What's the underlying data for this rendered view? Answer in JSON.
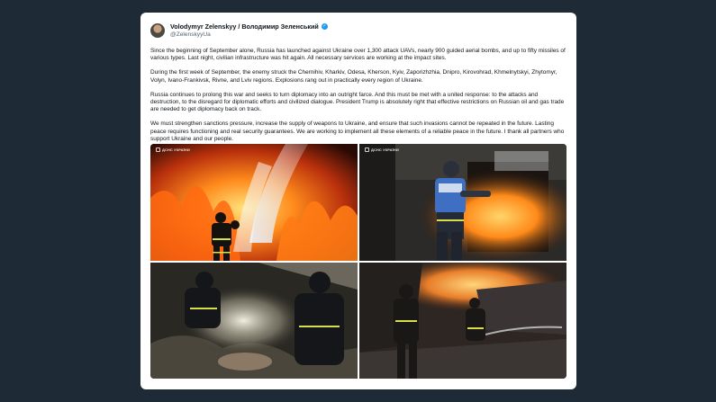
{
  "post": {
    "display_name": "Volodymyr Zelenskyy / Володимир Зеленський",
    "handle": "@ZelenskyyUa",
    "verified_icon": "verified-badge-icon",
    "paragraphs": [
      "Since the beginning of September alone, Russia has launched against Ukraine over 1,300 attack UAVs, nearly 900 guided aerial bombs, and up to fifty missiles of various types. Last night, civilian infrastructure was hit again. All necessary services are working at the impact sites.",
      "During the first week of September, the enemy struck the Chernihiv, Kharkiv, Odesa, Kherson, Kyiv, Zaporizhzhia, Dnipro, Kirovohrad, Khmelnytskyi, Zhytomyr, Volyn, Ivano-Frankivsk, Rivne, and Lviv regions. Explosions rang out in practically every region of Ukraine.",
      "Russia continues to prolong this war and seeks to turn diplomacy into an outright farce. And this must be met with a united response: to the attacks and destruction, to the disregard for diplomatic efforts and civilized dialogue. President Trump is absolutely right that effective restrictions on Russian oil and gas trade are needed to get diplomacy back on track.",
      "We must strengthen sanctions pressure, increase the supply of weapons to Ukraine, and ensure that such invasions cannot be repeated in the future. Lasting peace requires functioning and real security guarantees. We are working to implement all these elements of a reliable peace in the future. I thank all partners who support Ukraine and our people."
    ]
  },
  "photos": {
    "watermark_1": "ДСНС\nУКРАЇНИ",
    "watermark_2": "ДСНС УКРАЇНИ"
  }
}
